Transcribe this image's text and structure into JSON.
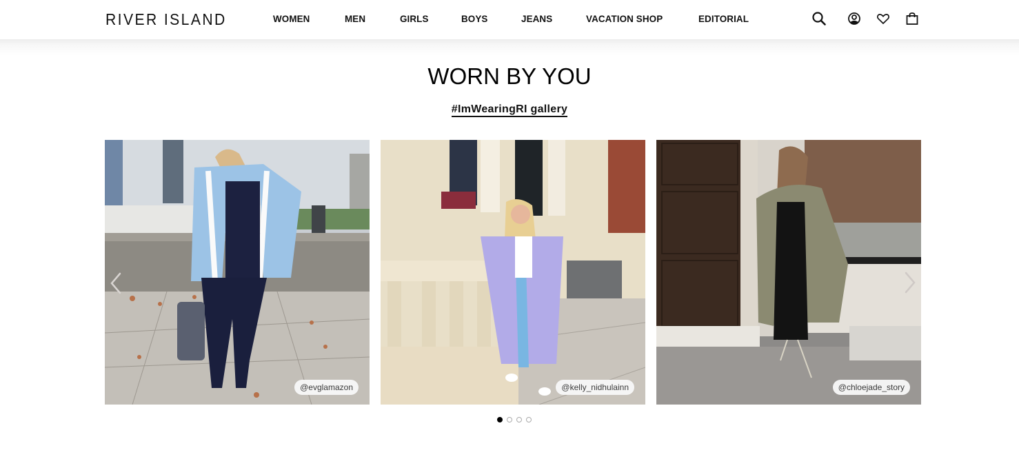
{
  "header": {
    "logo": "RIVER ISLAND",
    "nav": [
      {
        "label": "WOMEN"
      },
      {
        "label": "MEN"
      },
      {
        "label": "GIRLS"
      },
      {
        "label": "BOYS"
      },
      {
        "label": "JEANS"
      },
      {
        "label": "VACATION SHOP"
      },
      {
        "label": "EDITORIAL"
      }
    ],
    "icons": [
      "search-icon",
      "account-icon",
      "wishlist-heart-icon",
      "shopping-bag-icon"
    ]
  },
  "section": {
    "title": "WORN BY YOU",
    "gallery_link": "#ImWearingRI gallery"
  },
  "carousel": {
    "items": [
      {
        "handle": "@evglamazon",
        "description": "Woman in blue houndstooth jacket and navy jumpsuit by a riverside"
      },
      {
        "handle": "@kelly_nidhulainn",
        "description": "Woman in lilac houndstooth coat leaning on a white balustrade"
      },
      {
        "handle": "@chloejade_story",
        "description": "Woman in khaki quilted coat and black dress on a street"
      }
    ],
    "pagination": {
      "total": 4,
      "active": 1
    },
    "prev_icon": "chevron-left-icon",
    "next_icon": "chevron-right-icon"
  }
}
